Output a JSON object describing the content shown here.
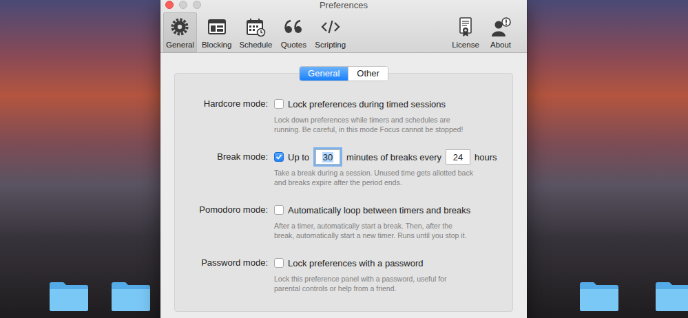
{
  "window": {
    "title": "Preferences",
    "controls": [
      {
        "kind": "close",
        "disabled": false
      },
      {
        "kind": "minimize",
        "disabled": true
      },
      {
        "kind": "zoom",
        "disabled": true
      }
    ]
  },
  "toolbar": {
    "items": [
      {
        "label": "General",
        "kind": "gear",
        "selected": true
      },
      {
        "label": "Blocking",
        "kind": "blocking",
        "selected": false
      },
      {
        "label": "Schedule",
        "kind": "calendar",
        "selected": false
      },
      {
        "label": "Quotes",
        "kind": "quotes",
        "selected": false
      },
      {
        "label": "Scripting",
        "kind": "code",
        "selected": false
      }
    ],
    "right_items": [
      {
        "label": "License",
        "kind": "certificate",
        "selected": false
      },
      {
        "label": "About",
        "kind": "person",
        "selected": false
      }
    ]
  },
  "segments": [
    {
      "label": "General",
      "selected": true
    },
    {
      "label": "Other",
      "selected": false
    }
  ],
  "settings": [
    {
      "label": "Hardcore mode:",
      "checked": false,
      "content": [
        {
          "kind": "text",
          "value": "Lock preferences during timed sessions"
        }
      ],
      "description": [
        "Lock down preferences while timers and schedules are",
        "running. Be careful, in this mode Focus cannot be stopped!"
      ]
    },
    {
      "label": "Break mode:",
      "checked": true,
      "content": [
        {
          "kind": "text",
          "value": "Up to"
        },
        {
          "kind": "field",
          "value": "30",
          "focused": true
        },
        {
          "kind": "text",
          "value": "minutes of breaks every"
        },
        {
          "kind": "field",
          "value": "24",
          "focused": false
        },
        {
          "kind": "text",
          "value": "hours"
        }
      ],
      "description": [
        "Take a break during a session. Unused time gets allotted back",
        "and breaks expire after the period ends."
      ]
    },
    {
      "label": "Pomodoro mode:",
      "checked": false,
      "content": [
        {
          "kind": "text",
          "value": "Automatically loop between timers and breaks"
        }
      ],
      "description": [
        "After a timer, automatically start a break. Then, after the",
        "break, automatically start a new timer. Runs until you stop it."
      ]
    },
    {
      "label": "Password mode:",
      "checked": false,
      "content": [
        {
          "kind": "text",
          "value": "Lock preferences with a password"
        }
      ],
      "description": [
        "Lock this preference panel with a password, useful for",
        "parental controls or help from a friend."
      ]
    }
  ]
}
